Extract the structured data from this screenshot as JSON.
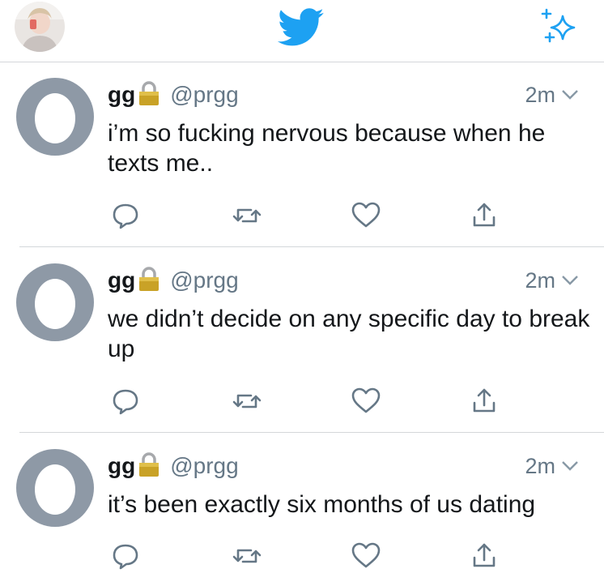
{
  "header": {
    "avatar_icon": "profile-avatar",
    "logo_icon": "twitter-bird-icon",
    "sparkle_icon": "top-tweets-sparkle-icon",
    "brand_color": "#1da1f2"
  },
  "tweets": [
    {
      "name": "gg",
      "handle": "@prgg",
      "time": "2m",
      "text": "i’m so fucking nervous because when he texts me.."
    },
    {
      "name": "gg",
      "handle": "@prgg",
      "time": "2m",
      "text": "we didn’t decide on any specific day to break up"
    },
    {
      "name": "gg",
      "handle": "@prgg",
      "time": "2m",
      "text": "it’s been exactly six months of us dating"
    }
  ],
  "colors": {
    "text": "#14171a",
    "secondary": "#657786",
    "icon": "#657786",
    "divider": "#d4d7da",
    "egg_bg": "#8e99a6"
  }
}
